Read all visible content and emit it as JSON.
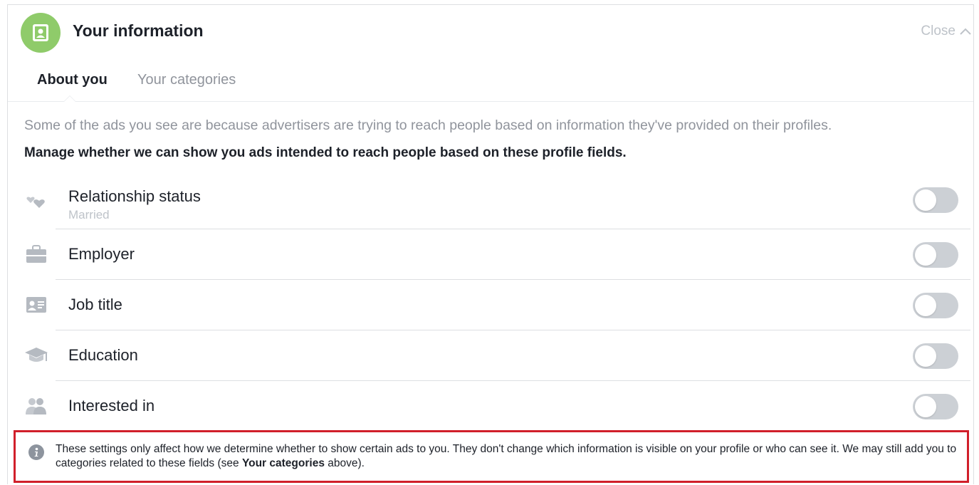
{
  "header": {
    "title": "Your information",
    "close_label": "Close",
    "icon": "profile-card-icon",
    "accent_color": "#8fcb6a"
  },
  "tabs": [
    {
      "label": "About you",
      "active": true
    },
    {
      "label": "Your categories",
      "active": false
    }
  ],
  "description": "Some of the ads you see are because advertisers are trying to reach people based on information they've provided on their profiles.",
  "manage_text": "Manage whether we can show you ads intended to reach people based on these profile fields.",
  "fields": [
    {
      "label": "Relationship status",
      "value": "Married",
      "icon": "hearts-icon",
      "enabled": false
    },
    {
      "label": "Employer",
      "icon": "briefcase-icon",
      "enabled": false
    },
    {
      "label": "Job title",
      "icon": "id-card-icon",
      "enabled": false
    },
    {
      "label": "Education",
      "icon": "graduation-cap-icon",
      "enabled": false
    },
    {
      "label": "Interested in",
      "icon": "people-icon",
      "enabled": false
    }
  ],
  "notice": {
    "text_before": "These settings only affect how we determine whether to show certain ads to you. They don't change which information is visible on your profile or who can see it. We may still add you to categories related to these fields (see ",
    "bold": "Your categories",
    "text_after": " above).",
    "icon": "info-icon",
    "highlight_color": "#d11f2a"
  }
}
